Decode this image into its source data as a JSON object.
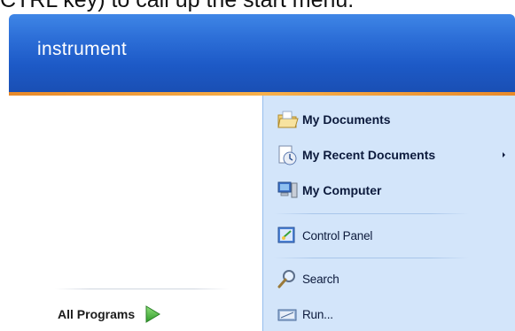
{
  "caption": "CTRL key) to call up the start menu.",
  "start_menu": {
    "user_name": "instrument",
    "all_programs_label": "All Programs",
    "right_items": [
      {
        "label": "My Documents",
        "icon": "folder-icon"
      },
      {
        "label": "My Recent Documents",
        "icon": "recent-documents-icon",
        "has_submenu": true
      },
      {
        "label": "My Computer",
        "icon": "computer-icon"
      },
      {
        "label": "Control Panel",
        "icon": "control-panel-icon"
      },
      {
        "label": "Search",
        "icon": "search-icon"
      },
      {
        "label": "Run...",
        "icon": "run-icon"
      }
    ]
  },
  "colors": {
    "header_blue": "#2d6fd8",
    "separator_orange": "#f7b04a",
    "right_pane_bg": "#d3e5fa",
    "all_programs_arrow": "#3fb03a"
  }
}
